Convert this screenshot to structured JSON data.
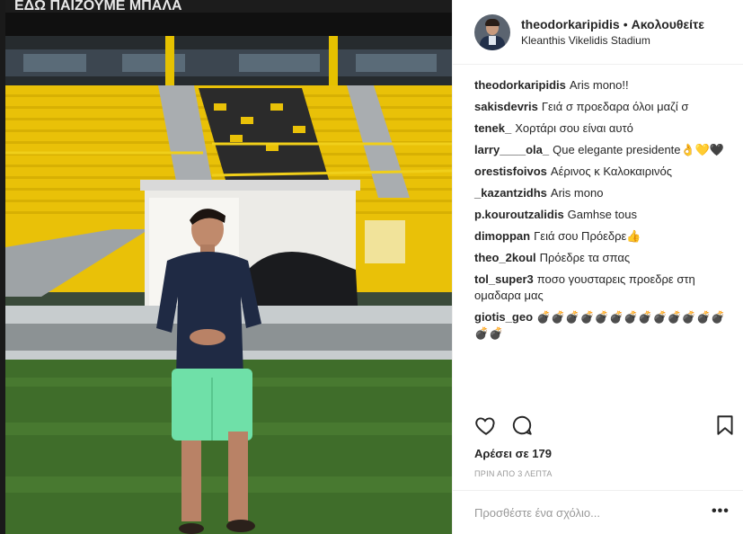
{
  "header": {
    "username": "theodorkaripidis",
    "separator": "•",
    "follow_status": "Ακολουθείτε",
    "location": "Kleanthis Vikelidis Stadium"
  },
  "photo": {
    "banner_text": "ΕΔΩ ΠΑΙΖΟΥΜΕ ΜΠΑΛΑ"
  },
  "comments": [
    {
      "user": "theodorkaripidis",
      "text": "Aris mono!!"
    },
    {
      "user": "sakisdevris",
      "text": "Γειά σ προεδαρα όλοι μαζί σ"
    },
    {
      "user": "tenek_",
      "text": "Χορτάρι σου είναι αυτό"
    },
    {
      "user": "larry____ola_",
      "text": "Que elegante presidente👌💛🖤"
    },
    {
      "user": "orestisfoivos",
      "text": "Αέρινος κ Καλοκαιρινός"
    },
    {
      "user": "_kazantzidhs",
      "text": "Aris mono"
    },
    {
      "user": "p.kouroutzalidis",
      "text": "Gamhse tous"
    },
    {
      "user": "dimoppan",
      "text": "Γειά σου Πρόεδρε👍"
    },
    {
      "user": "theo_2koul",
      "text": "Πρόεδρε τα σπας"
    },
    {
      "user": "tol_super3",
      "text": "ποσο γουσταρεις προεδρε στη ομαδαρα μας"
    },
    {
      "user": "giotis_geo",
      "text": "💣💣💣💣💣💣💣💣💣💣💣💣💣💣💣"
    }
  ],
  "actions": {
    "like_icon": "heart-icon",
    "comment_icon": "speech-bubble-icon",
    "save_icon": "bookmark-icon"
  },
  "likes": "Αρέσει σε 179",
  "timestamp": "ΠΡΙΝ ΑΠΟ 3 ΛΕΠΤΑ",
  "add_comment": {
    "placeholder": "Προσθέστε ένα σχόλιο...",
    "more_label": "•••"
  },
  "colors": {
    "seat_yellow": "#f2c500",
    "grass": "#3f6d2a",
    "shorts": "#6fe0a8",
    "shirt": "#1f2a44"
  }
}
